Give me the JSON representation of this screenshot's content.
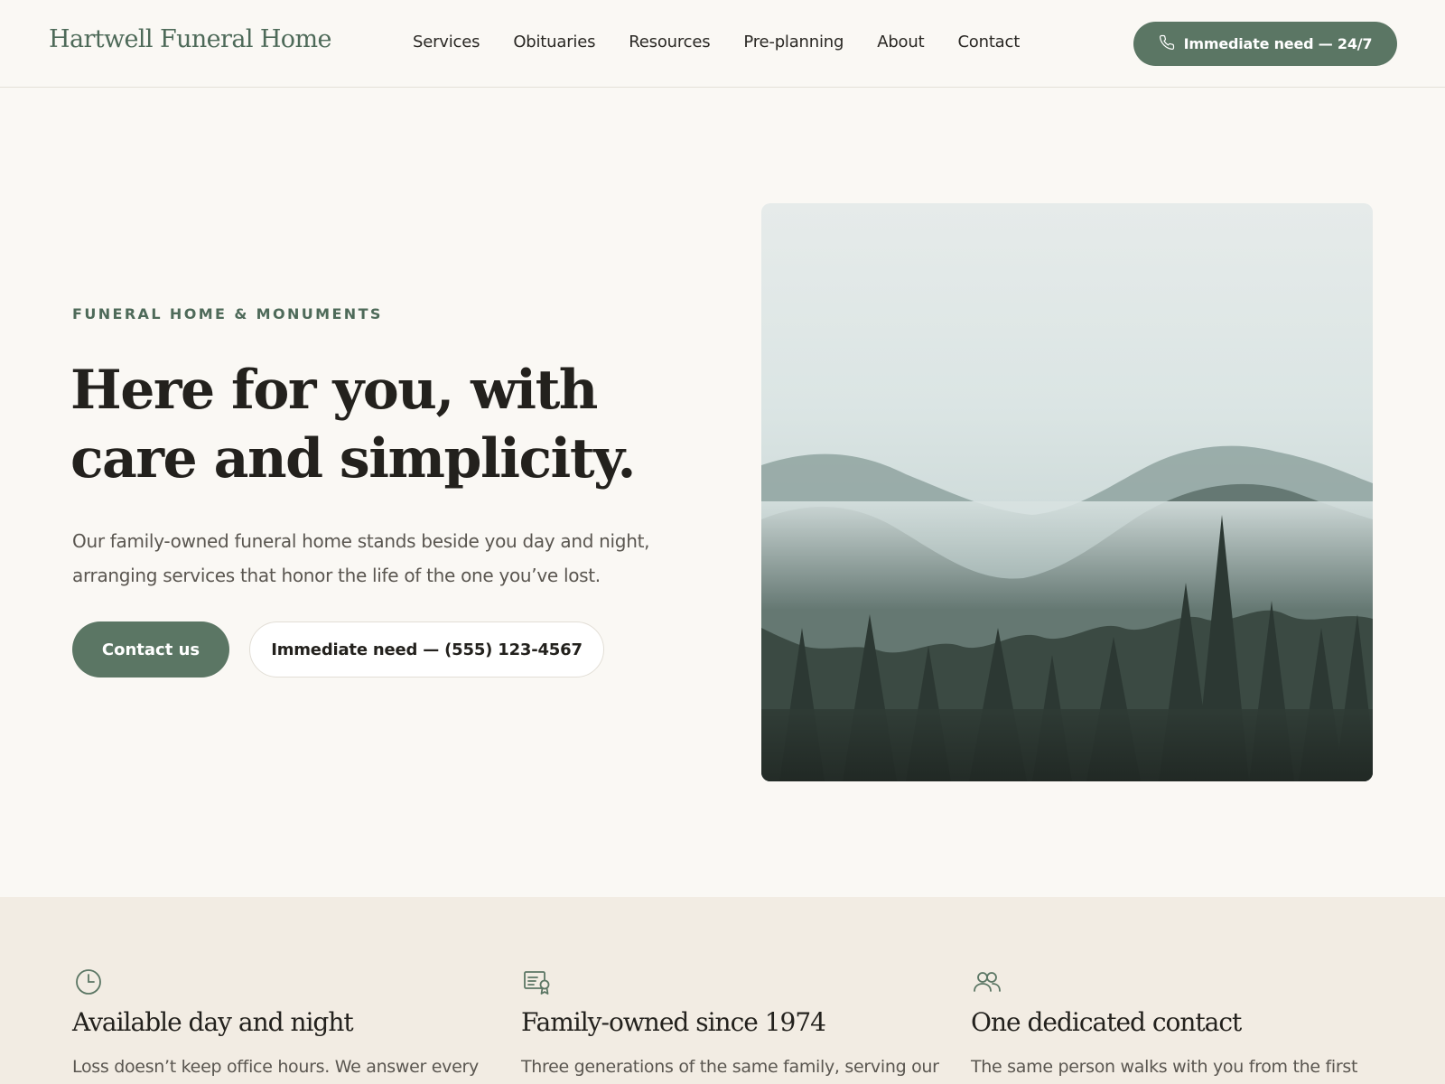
{
  "header": {
    "logo": "Hartwell Funeral Home",
    "nav": [
      "Services",
      "Obituaries",
      "Resources",
      "Pre-planning",
      "About",
      "Contact"
    ],
    "cta_label": "Immediate need — 24/7",
    "cta_icon": "phone-icon"
  },
  "hero": {
    "eyebrow": "FUNERAL HOME & MONUMENTS",
    "title": "Here for you, with care and simplicity.",
    "subtitle": "Our family-owned funeral home stands beside you day and night, arranging services that honor the life of the one you’ve lost.",
    "primary_button": "Contact us",
    "secondary_button": "Immediate need — (555) 123-4567",
    "image": "misty-forest-mountains"
  },
  "features": [
    {
      "icon": "clock-icon",
      "title": "Available day and night",
      "text": "Loss doesn’t keep office hours. We answer every"
    },
    {
      "icon": "certificate-icon",
      "title": "Family-owned since 1974",
      "text": "Three generations of the same family, serving our"
    },
    {
      "icon": "users-icon",
      "title": "One dedicated contact",
      "text": "The same person walks with you from the first"
    }
  ],
  "colors": {
    "accent": "#5b7664",
    "logo": "#4e6a59",
    "background": "#faf8f4",
    "features_background": "#f2ece3",
    "heading": "#23211d",
    "body_text": "#5a5650"
  }
}
